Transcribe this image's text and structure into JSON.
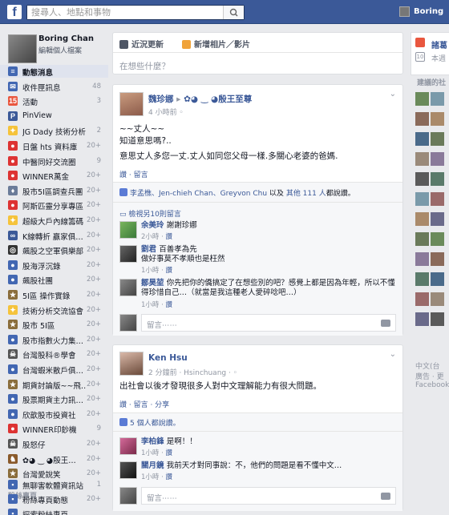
{
  "topbar": {
    "search_placeholder": "搜尋人、地點和事物",
    "user_name": "Boring",
    "brand_color": "#3b5998"
  },
  "sidebar": {
    "profile_name": "Boring Chan",
    "profile_edit": "編輯個人檔案",
    "items": [
      {
        "label": "動態消息",
        "count": "",
        "icon": "news-feed-icon",
        "color": "#4267b2"
      },
      {
        "label": "收件匣訊息",
        "count": "48",
        "icon": "messages-icon",
        "color": "#4267b2"
      },
      {
        "label": "活動",
        "count": "3",
        "icon": "events-icon",
        "color": "#e9573f"
      },
      {
        "label": "PinView",
        "count": "",
        "icon": "app-icon",
        "color": "#3b5998"
      },
      {
        "label": "JG Dady 技術分析…",
        "count": "2",
        "icon": "lightbulb-icon",
        "color": "#f5c33b"
      },
      {
        "label": "日盤 hts 資料庫",
        "count": "20+",
        "icon": "group-icon",
        "color": "#d33"
      },
      {
        "label": "中醫同好交流圈",
        "count": "9",
        "icon": "group-icon",
        "color": "#d33"
      },
      {
        "label": "WINNER萬金",
        "count": "20+",
        "icon": "group-icon",
        "color": "#d33"
      },
      {
        "label": "股市5I區調查兵團",
        "count": "20+",
        "icon": "shield-icon",
        "color": "#6b7c99"
      },
      {
        "label": "阿斯匹靈分享專區",
        "count": "20+",
        "icon": "group-icon",
        "color": "#d33"
      },
      {
        "label": "超級大戶內線籌碼",
        "count": "20+",
        "icon": "lightbulb-icon",
        "color": "#f5c33b"
      },
      {
        "label": "K線轉折 贏家俱…",
        "count": "20+",
        "icon": "link-icon",
        "color": "#3b5998"
      },
      {
        "label": "飆股之空軍俱樂部",
        "count": "20+",
        "icon": "target-icon",
        "color": "#333"
      },
      {
        "label": "股海浮沉錄",
        "count": "20+",
        "icon": "group-icon",
        "color": "#4267b2"
      },
      {
        "label": "飆股社團",
        "count": "20+",
        "icon": "group-icon",
        "color": "#4267b2"
      },
      {
        "label": "5I區 操作實錄",
        "count": "20+",
        "icon": "star-icon",
        "color": "#8a6d3b"
      },
      {
        "label": "技術分析交流協會",
        "count": "20+",
        "icon": "lightbulb-icon",
        "color": "#f5c33b"
      },
      {
        "label": "股市 5I區",
        "count": "20+",
        "icon": "star-icon",
        "color": "#8a6d3b"
      },
      {
        "label": "股市指數火力集…",
        "count": "20+",
        "icon": "group-icon",
        "color": "#4267b2"
      },
      {
        "label": "台灣股科®學會",
        "count": "20+",
        "icon": "skull-icon",
        "color": "#555"
      },
      {
        "label": "台灣蝦米散戶俱…",
        "count": "20+",
        "icon": "group-icon",
        "color": "#4267b2"
      },
      {
        "label": "期貨討論版~~飛…",
        "count": "20+",
        "icon": "star-icon",
        "color": "#8a6d3b"
      },
      {
        "label": "股票期貨主力訊…",
        "count": "20+",
        "icon": "group-icon",
        "color": "#4267b2"
      },
      {
        "label": "欣歆股市投資社",
        "count": "20+",
        "icon": "group-icon",
        "color": "#4267b2"
      },
      {
        "label": "WINNER印鈔機",
        "count": "9",
        "icon": "group-icon",
        "color": "#d33"
      },
      {
        "label": "股怒仔",
        "count": "20+",
        "icon": "skull-icon",
        "color": "#555"
      },
      {
        "label": "✿◕ ‿ ◕殷王…",
        "count": "20+",
        "icon": "horse-icon",
        "color": "#8a5a2b"
      },
      {
        "label": "台灣愛說笑",
        "count": "20+",
        "icon": "star-icon",
        "color": "#8a6d3b"
      }
    ],
    "section_pages": "粉絲專頁",
    "page_items": [
      {
        "label": "無聊害軟體資訊站",
        "count": "1",
        "icon": "page-icon",
        "color": "#4267b2"
      },
      {
        "label": "粉絲專頁動態",
        "count": "20+",
        "icon": "page-icon",
        "color": "#4267b2"
      },
      {
        "label": "探索粉絲專頁",
        "count": "",
        "icon": "page-icon",
        "color": "#4267b2"
      }
    ]
  },
  "composer": {
    "status_tab": "近況更新",
    "photo_tab": "新增相片／影片",
    "placeholder": "在想些什麼？"
  },
  "post1": {
    "author": "魏珍娜",
    "group_arrow": "▸",
    "group_name": "✿◕ ‿ ◕殷王至尊",
    "time": "4 小時前",
    "text_lines": [
      "~~丈人~~",
      "知道意思嗎?..",
      "意思丈人多您一丈.丈人如同您父母一樣.多關心老婆的爸媽."
    ],
    "action_links": "讚 · 留言",
    "likes": {
      "names": "李孟樵、Jen-chieh Chan、Greyvon Chu",
      "mid": "以及",
      "others": "其他 111 人",
      "suffix": "都說讚。"
    },
    "view_more": "檢視另10則留言",
    "comments": [
      {
        "name": "余美玲",
        "text": "謝謝珍娜",
        "meta": "2小時 · ",
        "like": "讚"
      },
      {
        "name": "劉君",
        "text": "百善孝為先",
        "text2": "做好事莫不孝順也是枉然",
        "meta": "1小時 · ",
        "like": "讚"
      },
      {
        "name": "鄒昊堃",
        "text": "你先把你的僑搞定了在想些別的吧？感覺上都是因為年輕，所以不懂得珍惜自己…（就當是我這種老人愛碎唸吧…）",
        "meta": "1小時 · ",
        "like": "讚"
      }
    ],
    "comment_placeholder": "留言⋯⋯"
  },
  "post2": {
    "author": "Ken Hsu",
    "time": "2 分鐘前 · Hsinchuang · ",
    "text": "出社會以後才發現很多人對中文理解能力有很大問題。",
    "action_links": "讚 · 留言 · 分享",
    "likes": "5 個人都說讚。",
    "comments": [
      {
        "name": "李柏鋒",
        "text": "是啊！！",
        "meta": "1小時 · ",
        "like": "讚"
      },
      {
        "name": "關月鏡",
        "text": "我前天才對同事說：不，他們的問題是看不懂中文…",
        "meta": "1小時 · ",
        "like": "讚"
      }
    ],
    "comment_placeholder": "留言⋯⋯"
  },
  "rightcol": {
    "card_name": "諸葛",
    "card_sub": "本週",
    "suggested": "建議的社",
    "footer1": "中文(台",
    "footer2": "廣告 · 更",
    "footer3": "Facebook"
  }
}
